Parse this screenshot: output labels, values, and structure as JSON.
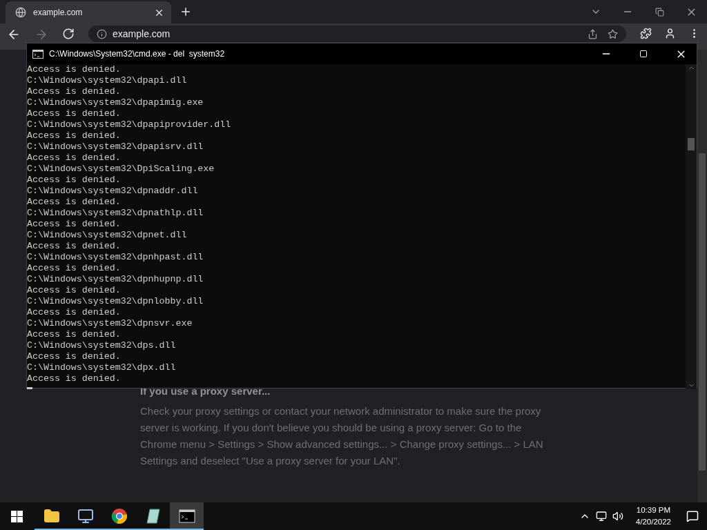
{
  "browser": {
    "tab": {
      "title": "example.com"
    },
    "window_controls": [
      {
        "kind": "dropdown"
      },
      {
        "kind": "minimize"
      },
      {
        "kind": "restore"
      },
      {
        "kind": "close"
      }
    ],
    "nav": [
      {
        "kind": "back",
        "disabled": false
      },
      {
        "kind": "forward",
        "disabled": true
      },
      {
        "kind": "reload",
        "disabled": false
      }
    ],
    "address": {
      "value": "example.com"
    },
    "page": {
      "heading": "If you use a proxy server...",
      "paragraph": "Check your proxy settings or contact your network administrator to make sure the proxy server is working. If you don't believe you should be using a proxy server: Go to the Chrome menu > Settings > Show advanced settings... > Change proxy settings... > LAN Settings and deselect \"Use a proxy server for your LAN\"."
    }
  },
  "console": {
    "title": "C:\\Windows\\System32\\cmd.exe - del  system32",
    "lines": [
      "Access is denied.",
      "C:\\Windows\\system32\\dpapi.dll",
      "Access is denied.",
      "C:\\Windows\\system32\\dpapimig.exe",
      "Access is denied.",
      "C:\\Windows\\system32\\dpapiprovider.dll",
      "Access is denied.",
      "C:\\Windows\\system32\\dpapisrv.dll",
      "Access is denied.",
      "C:\\Windows\\system32\\DpiScaling.exe",
      "Access is denied.",
      "C:\\Windows\\system32\\dpnaddr.dll",
      "Access is denied.",
      "C:\\Windows\\system32\\dpnathlp.dll",
      "Access is denied.",
      "C:\\Windows\\system32\\dpnet.dll",
      "Access is denied.",
      "C:\\Windows\\system32\\dpnhpast.dll",
      "Access is denied.",
      "C:\\Windows\\system32\\dpnhupnp.dll",
      "Access is denied.",
      "C:\\Windows\\system32\\dpnlobby.dll",
      "Access is denied.",
      "C:\\Windows\\system32\\dpnsvr.exe",
      "Access is denied.",
      "C:\\Windows\\system32\\dps.dll",
      "Access is denied.",
      "C:\\Windows\\system32\\dpx.dll",
      "Access is denied."
    ]
  },
  "taskbar": {
    "apps": [
      {
        "kind": "explorer",
        "selected": false
      },
      {
        "kind": "computer",
        "selected": false
      },
      {
        "kind": "chrome",
        "selected": false
      },
      {
        "kind": "notepad",
        "selected": false
      },
      {
        "kind": "terminal",
        "selected": true
      }
    ],
    "clock": {
      "time": "10:39 PM",
      "date": "4/20/2022"
    }
  }
}
